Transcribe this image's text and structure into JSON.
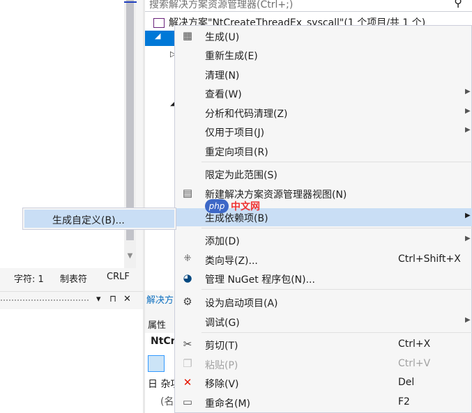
{
  "editor": {
    "statusbar": {
      "chars": "字符: 1",
      "tabs": "制表符",
      "eol": "CRLF"
    },
    "panel_buttons": {
      "dropdown": "▾",
      "pin": "⊓",
      "close": "✕"
    }
  },
  "solution_explorer": {
    "search_placeholder": "搜索解决方案资源管理器(Ctrl+;)",
    "solution_label": "解决方案\"NtCreateThreadEx_syscall\"(1 个项目/共 1 个)",
    "tab_label": "解决方",
    "properties_title": "属性",
    "properties_object": "NtCr",
    "properties_category": "日 杂项",
    "properties_item": "(名"
  },
  "context_menu": {
    "items": [
      {
        "label": "生成(U)",
        "icon": "build-icon"
      },
      {
        "label": "重新生成(E)"
      },
      {
        "label": "清理(N)"
      },
      {
        "label": "查看(W)",
        "submenu": true
      },
      {
        "label": "分析和代码清理(Z)",
        "submenu": true
      },
      {
        "label": "仅用于项目(J)",
        "submenu": true
      },
      {
        "label": "重定向项目(R)"
      },
      {
        "label": "限定为此范围(S)"
      },
      {
        "label": "新建解决方案资源管理器视图(N)",
        "icon": "new-view-icon"
      },
      {
        "label": "生成依赖项(B)",
        "submenu": true,
        "highlighted": true
      },
      {
        "label": "添加(D)",
        "submenu": true
      },
      {
        "label": "类向导(Z)...",
        "shortcut": "Ctrl+Shift+X",
        "icon": "class-wizard-icon"
      },
      {
        "label": "管理 NuGet 程序包(N)...",
        "icon": "nuget-icon"
      },
      {
        "label": "设为启动项目(A)",
        "icon": "gear-icon"
      },
      {
        "label": "调试(G)",
        "submenu": true
      },
      {
        "label": "剪切(T)",
        "shortcut": "Ctrl+X",
        "icon": "scissors-icon"
      },
      {
        "label": "粘贴(P)",
        "shortcut": "Ctrl+V",
        "icon": "paste-icon",
        "disabled": true
      },
      {
        "label": "移除(V)",
        "shortcut": "Del",
        "icon": "remove-icon"
      },
      {
        "label": "重命名(M)",
        "shortcut": "F2",
        "icon": "rename-icon"
      }
    ]
  },
  "submenu": {
    "item": "生成自定义(B)..."
  },
  "watermark": {
    "brand": "php",
    "site": "中文网"
  },
  "colors": {
    "accent": "#0078d7",
    "highlight": "#c9def5",
    "remove_red": "#e51400"
  }
}
